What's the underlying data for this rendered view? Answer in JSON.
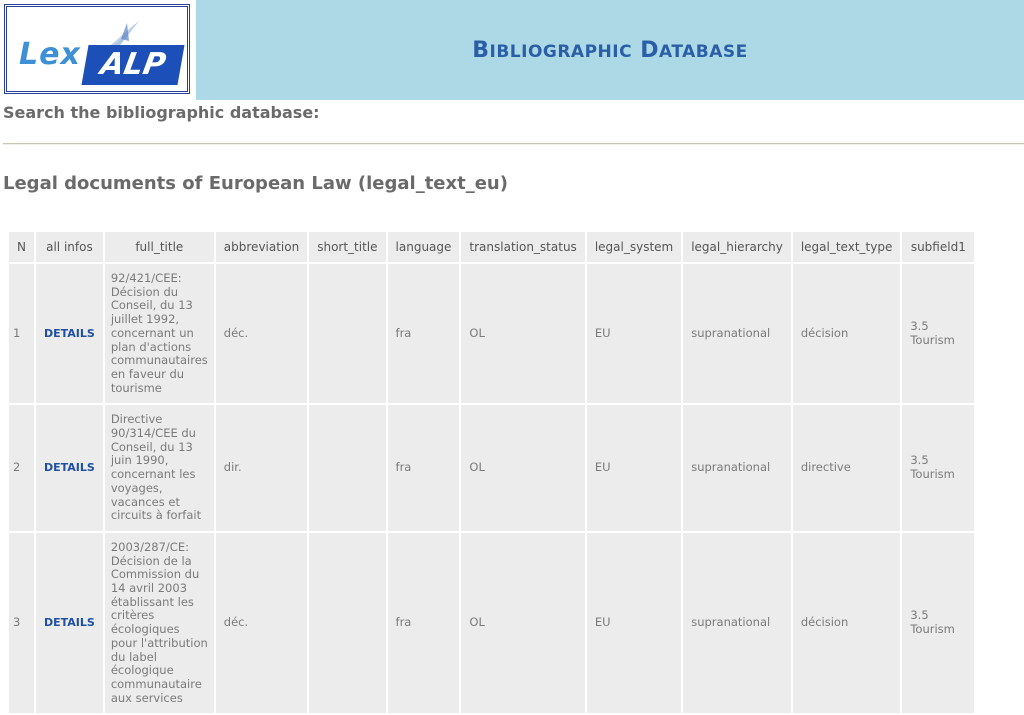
{
  "header": {
    "logo_text_left": "Lex",
    "logo_text_right": "ALP",
    "title_big1": "B",
    "title_small1": "IBLIOGRAPHIC",
    "title_big2": "D",
    "title_small2": "ATABASE"
  },
  "search": {
    "label": "Search the bibliographic database:"
  },
  "section": {
    "title": "Legal documents of European Law (legal_text_eu)"
  },
  "table": {
    "headers": [
      "N",
      "all infos",
      "full_title",
      "abbreviation",
      "short_title",
      "language",
      "translation_status",
      "legal_system",
      "legal_hierarchy",
      "legal_text_type",
      "subfield1"
    ],
    "rows": [
      {
        "n": "1",
        "details": "DETAILS",
        "full_title": "92/421/CEE: Décision du Conseil, du 13 juillet 1992, concernant un plan d'actions communautaires en faveur du tourisme",
        "abbreviation": "déc.",
        "short_title": "",
        "language": "fra",
        "translation_status": "OL",
        "legal_system": "EU",
        "legal_hierarchy": "supranational",
        "legal_text_type": "décision",
        "subfield1": "3.5 Tourism"
      },
      {
        "n": "2",
        "details": "DETAILS",
        "full_title": "Directive 90/314/CEE du Conseil, du 13 juin 1990, concernant les voyages, vacances et circuits à forfait",
        "abbreviation": "dir.",
        "short_title": "",
        "language": "fra",
        "translation_status": "OL",
        "legal_system": "EU",
        "legal_hierarchy": "supranational",
        "legal_text_type": "directive",
        "subfield1": "3.5 Tourism"
      },
      {
        "n": "3",
        "details": "DETAILS",
        "full_title": "2003/287/CE: Décision de la Commission du 14 avril 2003 établissant les critères écologiques pour l'attribution du label écologique communautaire aux services",
        "abbreviation": "déc.",
        "short_title": "",
        "language": "fra",
        "translation_status": "OL",
        "legal_system": "EU",
        "legal_hierarchy": "supranational",
        "legal_text_type": "décision",
        "subfield1": "3.5 Tourism"
      }
    ]
  },
  "colors": {
    "header_bg": "#add8e6",
    "title_blue": "#2a5fa8",
    "link_blue": "#1f4fa5",
    "cell_bg": "#ececec"
  }
}
